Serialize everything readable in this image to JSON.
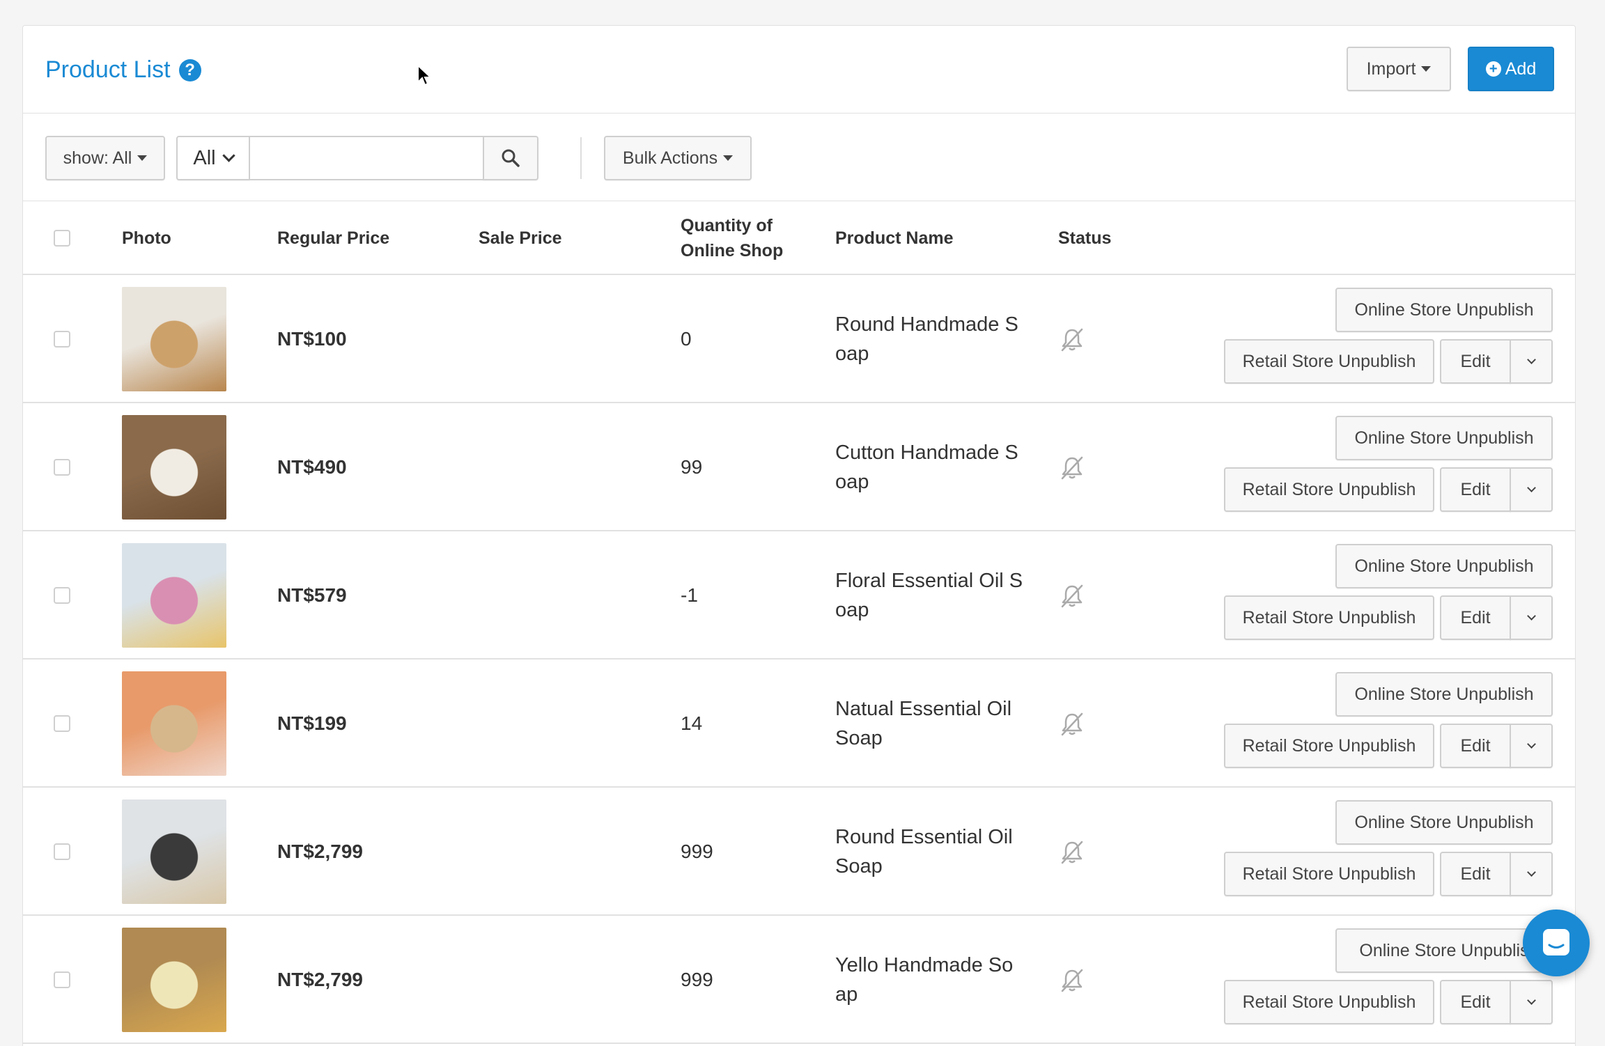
{
  "header": {
    "title": "Product List",
    "help_icon": "question-circle-icon",
    "import_label": "Import",
    "add_label": "Add"
  },
  "toolbar": {
    "show_label": "show: All",
    "filter_value": "All",
    "search_value": "",
    "search_icon": "search-icon",
    "bulk_label": "Bulk Actions"
  },
  "table": {
    "columns": {
      "photo": "Photo",
      "regular_price": "Regular Price",
      "sale_price": "Sale Price",
      "qty_line1": "Quantity of",
      "qty_line2": "Online Shop",
      "product_name": "Product Name",
      "status": "Status"
    },
    "rows": [
      {
        "regular_price": "NT$100",
        "sale_price": "",
        "qty": "0",
        "name": "Round Handmade Soap",
        "status_icon": "bell-slash-icon",
        "online_label": "Online Store Unpublish",
        "retail_label": "Retail Store Unpublish",
        "edit_label": "Edit",
        "photo_colors": [
          "#e9e4dc",
          "#cda16a",
          "#b8864d"
        ]
      },
      {
        "regular_price": "NT$490",
        "sale_price": "",
        "qty": "99",
        "name": "Cutton Handmade Soap",
        "status_icon": "bell-slash-icon",
        "online_label": "Online Store Unpublish",
        "retail_label": "Retail Store Unpublish",
        "edit_label": "Edit",
        "photo_colors": [
          "#8a6a4b",
          "#f1ece3",
          "#6e4f33"
        ]
      },
      {
        "regular_price": "NT$579",
        "sale_price": "",
        "qty": "-1",
        "name": "Floral Essential Oil Soap",
        "status_icon": "bell-slash-icon",
        "online_label": "Online Store Unpublish",
        "retail_label": "Retail Store Unpublish",
        "edit_label": "Edit",
        "photo_colors": [
          "#d9e2e8",
          "#d98fb2",
          "#e8c46a"
        ]
      },
      {
        "regular_price": "NT$199",
        "sale_price": "",
        "qty": "14",
        "name": "Natual Essential Oil Soap",
        "status_icon": "bell-slash-icon",
        "online_label": "Online Store Unpublish",
        "retail_label": "Retail Store Unpublish",
        "edit_label": "Edit",
        "photo_colors": [
          "#e89a6a",
          "#d6b78c",
          "#f0d5c8"
        ]
      },
      {
        "regular_price": "NT$2,799",
        "sale_price": "",
        "qty": "999",
        "name": "Round Essential Oil Soap",
        "status_icon": "bell-slash-icon",
        "online_label": "Online Store Unpublish",
        "retail_label": "Retail Store Unpublish",
        "edit_label": "Edit",
        "photo_colors": [
          "#dfe3e6",
          "#3a3a3a",
          "#d8c7a8"
        ]
      },
      {
        "regular_price": "NT$2,799",
        "sale_price": "",
        "qty": "999",
        "name": "Yello Handmade Soap",
        "status_icon": "bell-slash-icon",
        "online_label": "Online Store Unpublis",
        "retail_label": "Retail Store Unpublish",
        "edit_label": "Edit",
        "photo_colors": [
          "#b08a52",
          "#efe6b8",
          "#d9a84e"
        ]
      }
    ]
  },
  "chat_icon": "chat-bubble-icon",
  "colors": {
    "accent": "#1a8ad4"
  }
}
